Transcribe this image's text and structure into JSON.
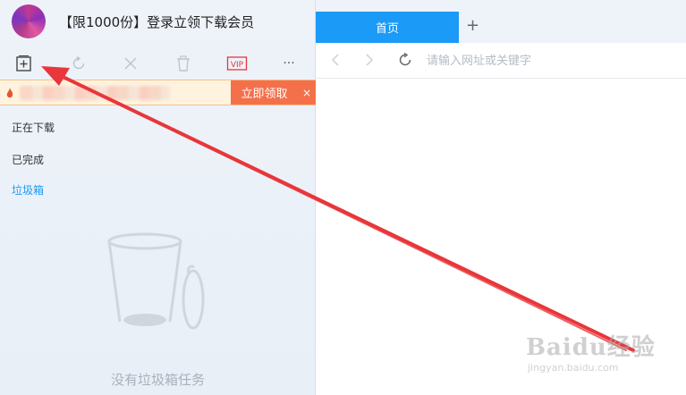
{
  "app": {
    "promo_title": "【限1000份】登录立领下载会员"
  },
  "toolbar": {
    "vip_label": "VIP",
    "more_label": "···",
    "icons": [
      "new-task-icon",
      "refresh-icon",
      "close-icon",
      "delete-icon",
      "vip-icon",
      "more-icon"
    ]
  },
  "banner": {
    "claim_label": "立即领取",
    "close_label": "×"
  },
  "sidebar": {
    "items": [
      {
        "label": "正在下载"
      },
      {
        "label": "已完成"
      },
      {
        "label": "垃圾箱",
        "active": true
      }
    ]
  },
  "trash": {
    "empty_text": "没有垃圾箱任务"
  },
  "browser": {
    "tabs": [
      {
        "label": "首页"
      }
    ],
    "add_tab_label": "+",
    "address_placeholder": "请输入网址或关键字"
  },
  "watermark": {
    "main": "Baidu经验",
    "sub": "jingyan.baidu.com"
  },
  "colors": {
    "accent": "#1b9af7",
    "banner_button": "#f4704b",
    "arrow": "#e8363a"
  }
}
